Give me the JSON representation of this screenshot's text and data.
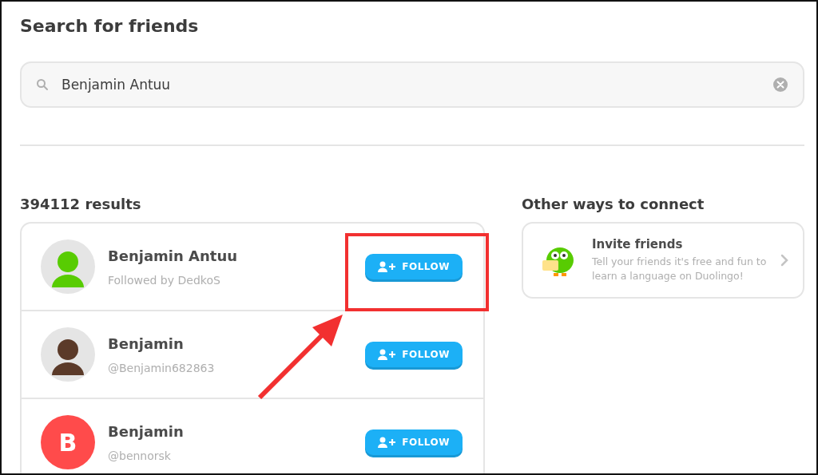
{
  "title": "Search for friends",
  "search": {
    "value": "Benjamin Antuu"
  },
  "results": {
    "count": "394112 results",
    "rows": [
      {
        "name": "Benjamin Antuu",
        "subtitle": "Followed by DedkoS",
        "avatar": {
          "kind": "character",
          "color": "#58cc02"
        },
        "button": "FOLLOW",
        "highlighted": true
      },
      {
        "name": "Benjamin",
        "subtitle": "@Benjamin682863",
        "avatar": {
          "kind": "character",
          "color": "#5b3a29"
        },
        "button": "FOLLOW",
        "highlighted": false
      },
      {
        "name": "Benjamin",
        "subtitle": "@bennorsk",
        "avatar": {
          "kind": "letter",
          "letter": "B",
          "color": "#ff4b4b"
        },
        "button": "FOLLOW",
        "highlighted": false
      }
    ]
  },
  "connect": {
    "heading": "Other ways to connect",
    "items": [
      {
        "title": "Invite friends",
        "description": "Tell your friends it's free and fun to learn a language on Duolingo!"
      }
    ]
  }
}
